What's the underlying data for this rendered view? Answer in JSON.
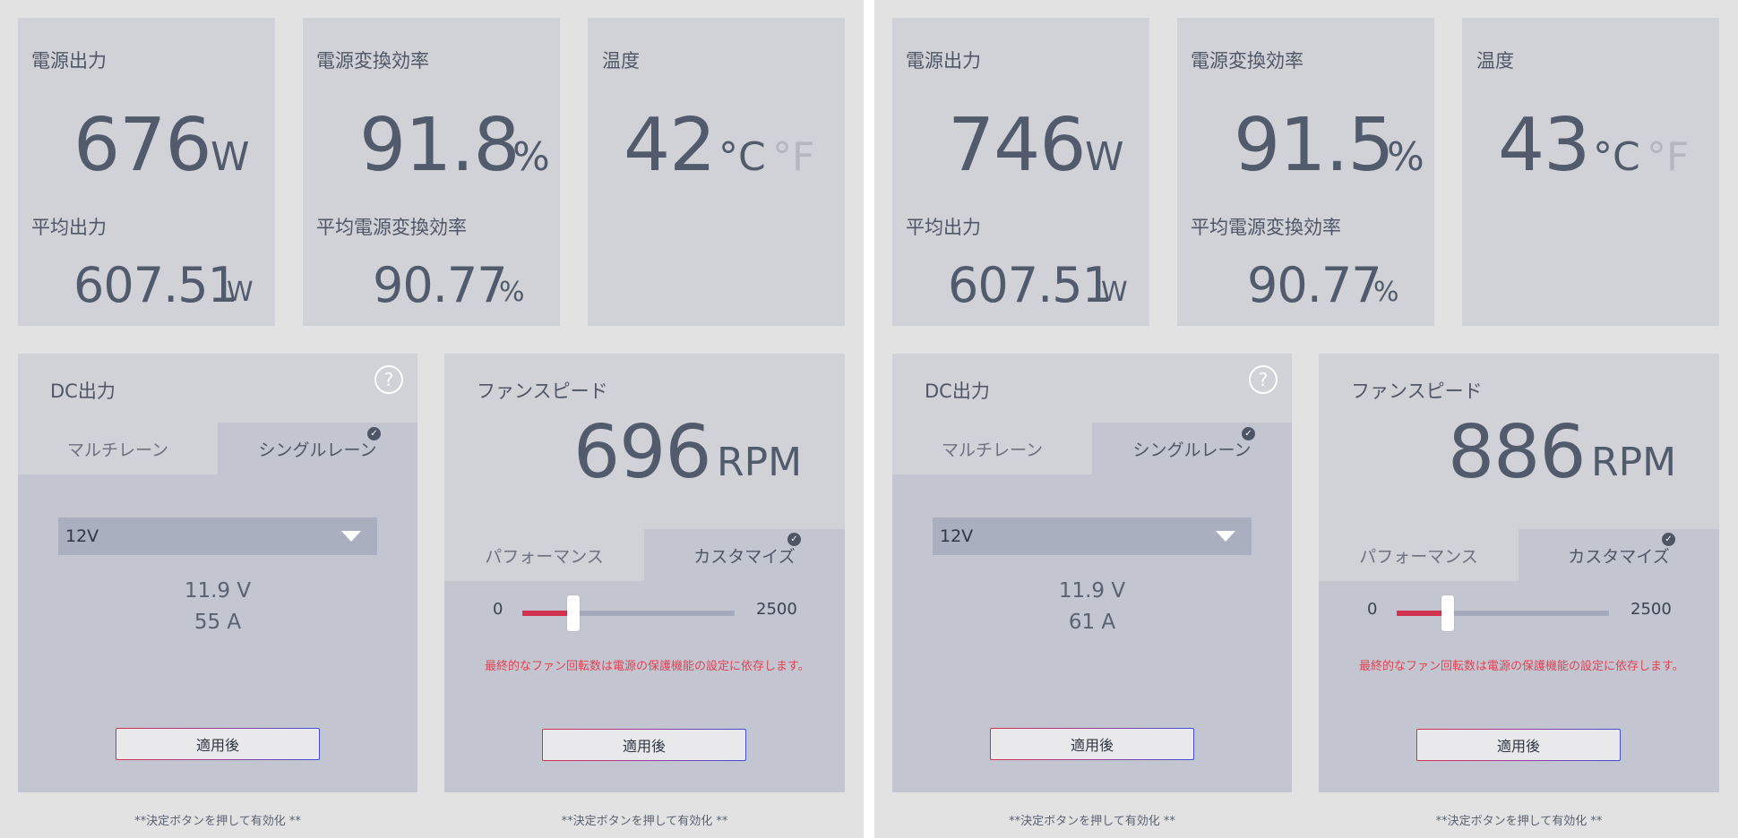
{
  "panels": [
    {
      "power": {
        "title": "電源出力",
        "value": "676",
        "unit": "W",
        "avg_title": "平均出力",
        "avg_value": "607.51",
        "avg_unit": "W"
      },
      "efficiency": {
        "title": "電源変換効率",
        "value": "91.8",
        "unit": "%",
        "avg_title": "平均電源変換効率",
        "avg_value": "90.77",
        "avg_unit": "%"
      },
      "temperature": {
        "title": "温度",
        "value": "42",
        "unit_c": "°C",
        "unit_f": "°F"
      },
      "dc": {
        "title": "DC出力",
        "help_glyph": "?",
        "tab_multi": "マルチレーン",
        "tab_single": "シングルレーン",
        "rail_select": "12V",
        "voltage": "11.9 V",
        "current": "55 A",
        "apply_label": "適用後",
        "note": "**決定ボタンを押して有効化 **"
      },
      "fan": {
        "title": "ファンスピード",
        "value": "696",
        "unit": "RPM",
        "tab_perf": "パフォーマンス",
        "tab_custom": "カスタマイズ",
        "slider_min": "0",
        "slider_max": "2500",
        "slider_fraction": 0.24,
        "warning": "最終的なファン回転数は電源の保護機能の設定に依存します。",
        "apply_label": "適用後",
        "note": "**決定ボタンを押して有効化 **"
      }
    },
    {
      "power": {
        "title": "電源出力",
        "value": "746",
        "unit": "W",
        "avg_title": "平均出力",
        "avg_value": "607.51",
        "avg_unit": "W"
      },
      "efficiency": {
        "title": "電源変換効率",
        "value": "91.5",
        "unit": "%",
        "avg_title": "平均電源変換効率",
        "avg_value": "90.77",
        "avg_unit": "%"
      },
      "temperature": {
        "title": "温度",
        "value": "43",
        "unit_c": "°C",
        "unit_f": "°F"
      },
      "dc": {
        "title": "DC出力",
        "help_glyph": "?",
        "tab_multi": "マルチレーン",
        "tab_single": "シングルレーン",
        "rail_select": "12V",
        "voltage": "11.9 V",
        "current": "61 A",
        "apply_label": "適用後",
        "note": "**決定ボタンを押して有効化 **"
      },
      "fan": {
        "title": "ファンスピード",
        "value": "886",
        "unit": "RPM",
        "tab_perf": "パフォーマンス",
        "tab_custom": "カスタマイズ",
        "slider_min": "0",
        "slider_max": "2500",
        "slider_fraction": 0.24,
        "warning": "最終的なファン回転数は電源の保護機能の設定に依存します。",
        "apply_label": "適用後",
        "note": "**決定ボタンを押して有効化 **"
      }
    }
  ],
  "colors": {
    "accent_red": "#d2334f",
    "gradient_start": "#d6304d",
    "gradient_end": "#3f4fd6",
    "card_bg": "#d1d2d7",
    "tab_body_bg": "#c3c5d0"
  }
}
